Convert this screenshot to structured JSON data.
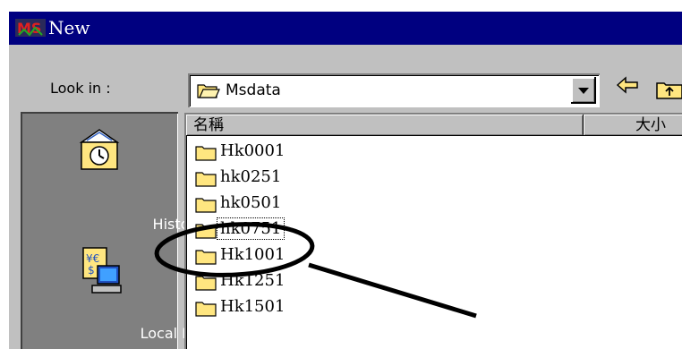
{
  "window": {
    "title": "New",
    "logo": "MS"
  },
  "toolbar": {
    "look_in_label": "Look in :",
    "look_in_value": "Msdata",
    "back_icon": "left-arrow-icon",
    "up_icon": "up-folder-icon"
  },
  "places": [
    {
      "label": "History",
      "icon": "history-icon"
    },
    {
      "label": "Local Data",
      "icon": "local-data-icon"
    }
  ],
  "file_list": {
    "columns": [
      "名稱",
      "大小"
    ],
    "rows": [
      {
        "name": "Hk0001"
      },
      {
        "name": "hk0251"
      },
      {
        "name": "hk0501"
      },
      {
        "name": "hk0751",
        "focused": true
      },
      {
        "name": "Hk1001"
      },
      {
        "name": "Hk1251"
      },
      {
        "name": "Hk1501"
      }
    ]
  },
  "colors": {
    "titlebar": "#000080",
    "face": "#c0c0c0",
    "places_bg": "#808080",
    "folder": "#ffe680"
  }
}
